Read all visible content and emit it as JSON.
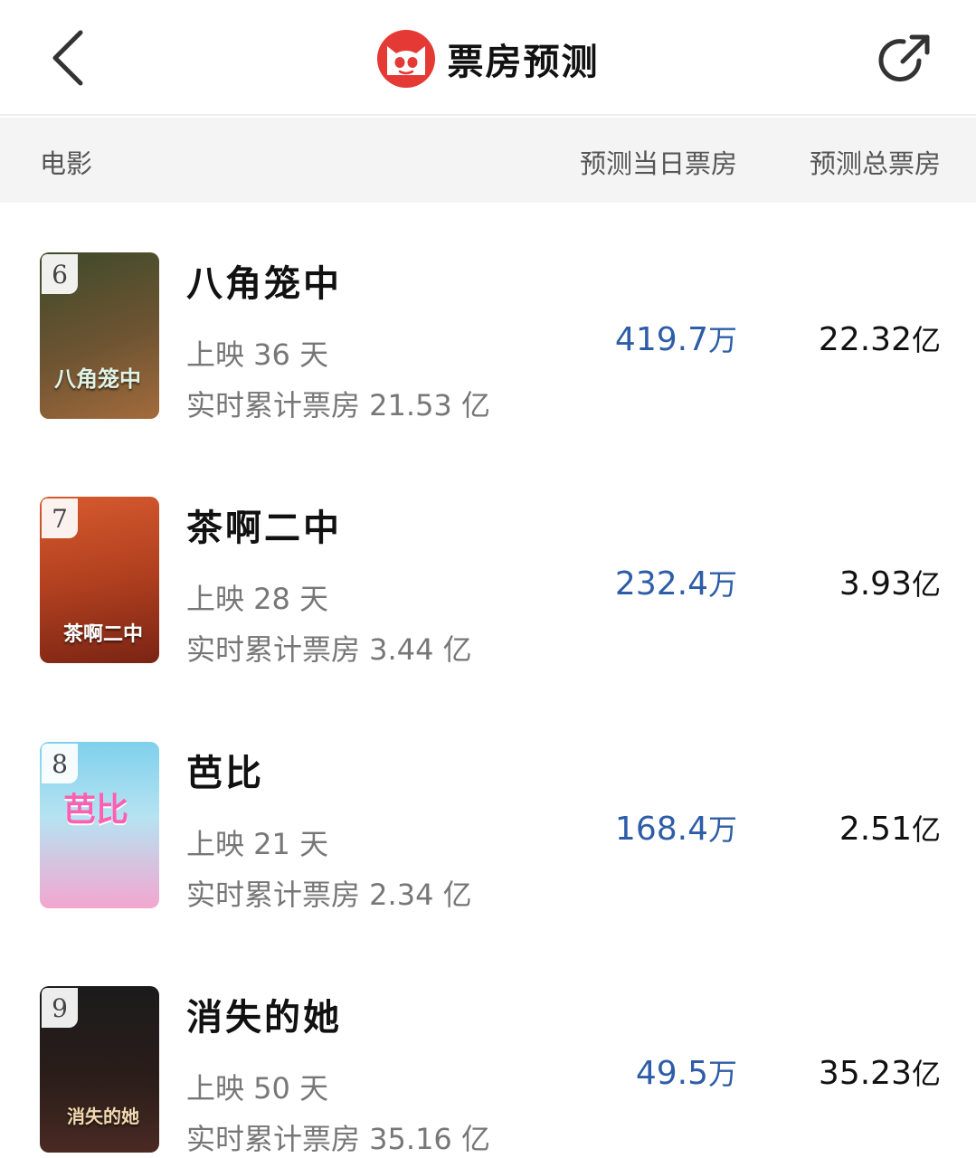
{
  "header": {
    "title": "票房预测",
    "back_icon": "chevron-left-icon",
    "share_icon": "share-icon",
    "logo_icon": "cat-logo-icon",
    "brand_color": "#e53935"
  },
  "columns": {
    "movie": "电影",
    "today": "预测当日票房",
    "total": "预测总票房"
  },
  "movies": [
    {
      "rank": "6",
      "title": "八角笼中",
      "days": "上映 36 天",
      "cumulative": "实时累计票房 21.53 亿",
      "today_value": "419.7",
      "today_unit": "万",
      "total_value": "22.32",
      "total_unit": "亿",
      "poster_text": "八角笼中",
      "poster_colors": [
        "#3d4a2a",
        "#a36b3c"
      ]
    },
    {
      "rank": "7",
      "title": "茶啊二中",
      "days": "上映 28 天",
      "cumulative": "实时累计票房 3.44 亿",
      "today_value": "232.4",
      "today_unit": "万",
      "total_value": "3.93",
      "total_unit": "亿",
      "poster_text": "茶啊二中",
      "poster_colors": [
        "#c94a2a",
        "#7a2414"
      ]
    },
    {
      "rank": "8",
      "title": "芭比",
      "days": "上映 21 天",
      "cumulative": "实时累计票房 2.34 亿",
      "today_value": "168.4",
      "today_unit": "万",
      "total_value": "2.51",
      "total_unit": "亿",
      "poster_text": "芭比",
      "poster_colors": [
        "#7fd0ec",
        "#f3a6cf"
      ]
    },
    {
      "rank": "9",
      "title": "消失的她",
      "days": "上映 50 天",
      "cumulative": "实时累计票房 35.16 亿",
      "today_value": "49.5",
      "today_unit": "万",
      "total_value": "35.23",
      "total_unit": "亿",
      "poster_text": "消失的她",
      "poster_colors": [
        "#1b1b1b",
        "#4a2a22"
      ]
    }
  ]
}
